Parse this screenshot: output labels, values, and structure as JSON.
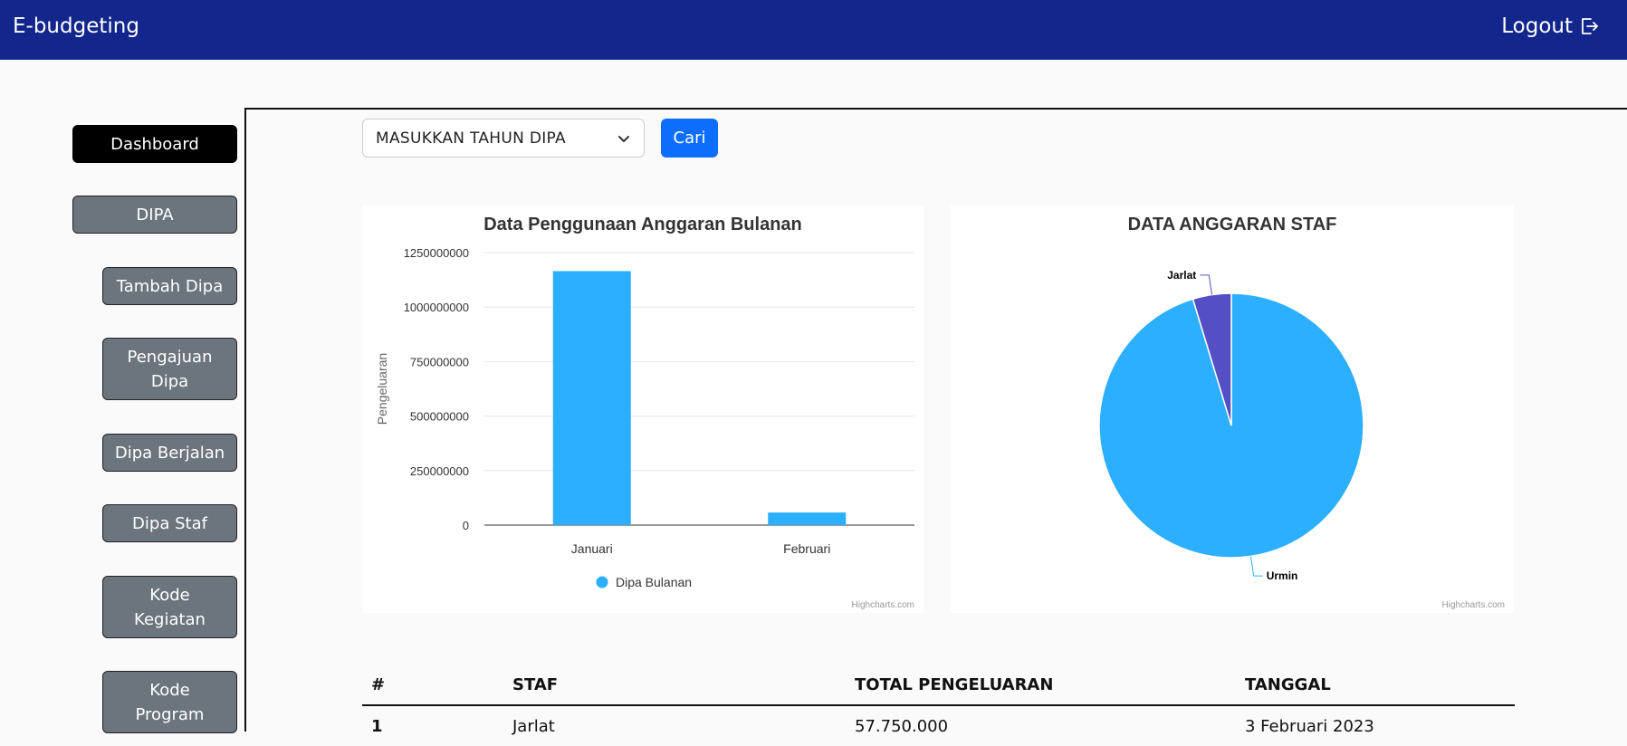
{
  "header": {
    "brand": "E-budgeting",
    "logout_label": "Logout",
    "logout_icon": "logout-icon",
    "background_color": "#12268b"
  },
  "sidebar": {
    "items": [
      {
        "label": "Dashboard",
        "active": true
      },
      {
        "label": "DIPA",
        "active": false
      },
      {
        "label": "Tambah Dipa",
        "active": false
      },
      {
        "label": "Pengajuan Dipa",
        "active": false
      },
      {
        "label": "Dipa Berjalan",
        "active": false
      },
      {
        "label": "Dipa Staf",
        "active": false
      },
      {
        "label": "Kode Kegiatan",
        "active": false
      },
      {
        "label": "Kode Program",
        "active": false
      }
    ]
  },
  "filter": {
    "select_value": "MASUKKAN TAHUN DIPA",
    "search_button": "Cari"
  },
  "chart_data": [
    {
      "type": "bar",
      "title": "Data Penggunaan Anggaran Bulanan",
      "ylabel": "Pengeluaran",
      "xlabel": "",
      "categories": [
        "Januari",
        "Februari"
      ],
      "series": [
        {
          "name": "Dipa Bulanan",
          "values": [
            1165000000,
            57750000
          ],
          "color": "#2caffe"
        }
      ],
      "ylim": [
        0,
        1250000000
      ],
      "yticks": [
        "0",
        "250000000",
        "500000000",
        "750000000",
        "1000000000",
        "1250000000"
      ],
      "grid": true,
      "legend": "bottom-center",
      "credit": "Highcharts.com"
    },
    {
      "type": "pie",
      "title": "DATA ANGGARAN STAF",
      "slices": [
        {
          "label": "Urmin",
          "value": 95.3,
          "color": "#2caffe"
        },
        {
          "label": "Jarlat",
          "value": 4.7,
          "color": "#544fc5"
        }
      ],
      "legend": "none",
      "credit": "Highcharts.com"
    }
  ],
  "table": {
    "columns": [
      "#",
      "STAF",
      "TOTAL PENGELUARAN",
      "TANGGAL"
    ],
    "rows": [
      [
        "1",
        "Jarlat",
        "57.750.000",
        "3 Februari 2023"
      ]
    ]
  }
}
